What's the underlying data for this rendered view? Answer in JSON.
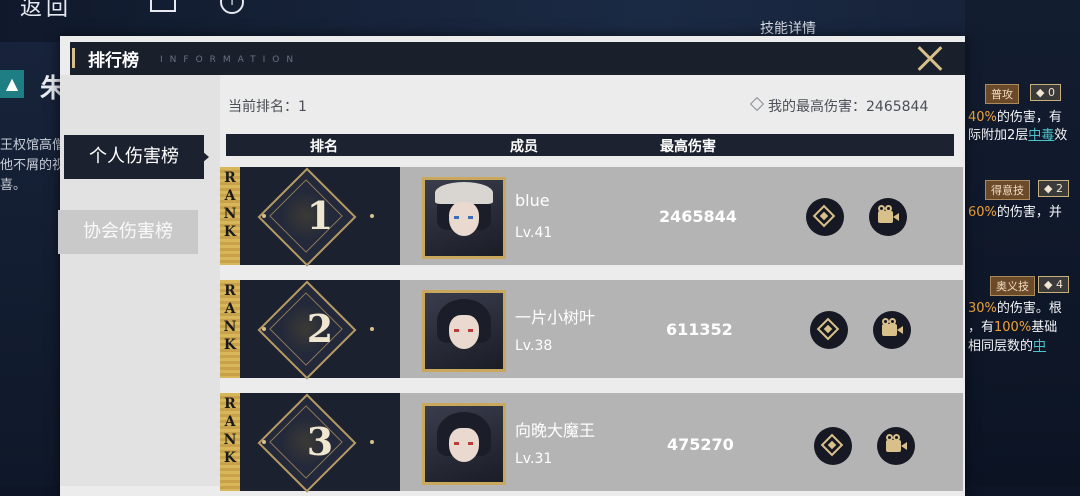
{
  "background": {
    "back_label": "返回",
    "character_name": "朱",
    "left_text": [
      "王权馆高僧",
      "他不屑的视",
      "喜。"
    ],
    "skill_panel_title": "技能详情",
    "skills": [
      {
        "tag": "普攻",
        "cost": "0",
        "line1_value": "40%",
        "line1_text": "的伤害，有",
        "line2_a": "际附加2层",
        "line2_hl": "中毒",
        "line2_b": "效"
      },
      {
        "tag": "得意技",
        "cost": "2",
        "line1_value": "60%",
        "line1_text": "的伤害，并"
      },
      {
        "tag": "奥义技",
        "cost": "4",
        "line1_value": "30%",
        "line1_text": "的伤害。根",
        "line2_a": "，有",
        "line2_hl": "100%",
        "line2_b": "基础",
        "line3_a": "相同层数的",
        "line3_hl": "中"
      }
    ]
  },
  "window": {
    "title": "排行榜",
    "subtitle": "INFORMATION",
    "tabs": [
      {
        "label": "个人伤害榜",
        "active": true
      },
      {
        "label": "协会伤害榜",
        "active": false
      }
    ],
    "current_rank": "当前排名：1",
    "best_damage": "我的最高伤害：2465844",
    "columns": [
      "排名",
      "成员",
      "最高伤害"
    ],
    "rank_word": "RANK",
    "rows": [
      {
        "rank": "1",
        "name": "blue",
        "level": "Lv.41",
        "damage": "2465844",
        "avatar": "hooded-character-avatar-icon"
      },
      {
        "rank": "2",
        "name": "一片小树叶",
        "level": "Lv.38",
        "damage": "611352",
        "avatar": "dark-hair-character-avatar-icon"
      },
      {
        "rank": "3",
        "name": "向晚大魔王",
        "level": "Lv.31",
        "damage": "475270",
        "avatar": "dark-hair-character-avatar-icon"
      }
    ],
    "row_actions": [
      "lineup-icon",
      "replay-camera-icon"
    ]
  },
  "colors": {
    "accent_gold": "#d8c08a",
    "dark_navy": "#1c2130",
    "panel_bg": "#ececec"
  }
}
